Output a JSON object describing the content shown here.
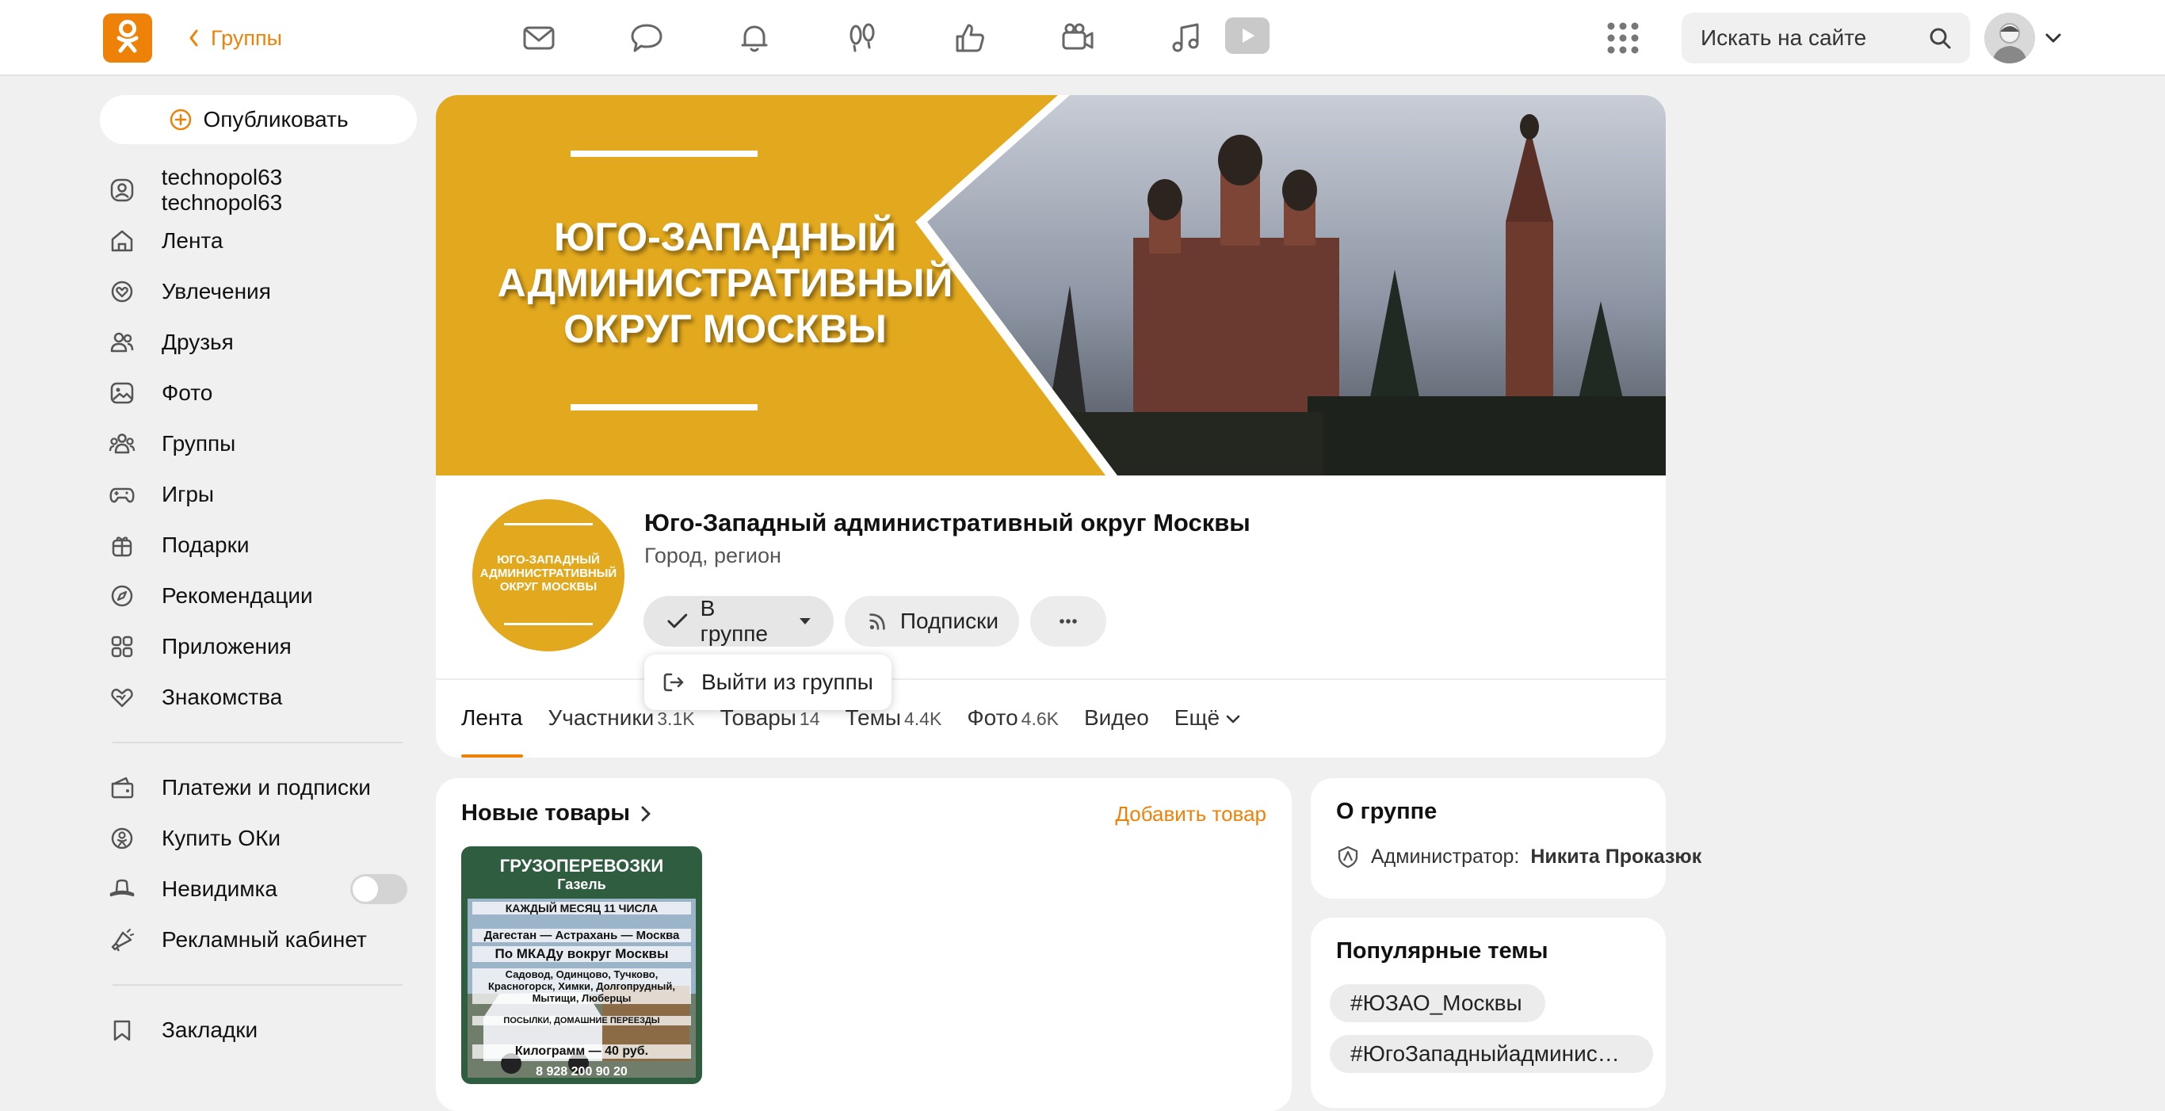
{
  "topbar": {
    "breadcrumb": "Группы",
    "search_placeholder": "Искать на сайте",
    "nav_icons": [
      "mail-icon",
      "chat-icon",
      "bell-icon",
      "guests-icon",
      "like-icon",
      "camera-icon",
      "music-icon",
      "video-icon"
    ]
  },
  "sidebar": {
    "publish_label": "Опубликовать",
    "items": [
      {
        "label": "technopol63 technopol63",
        "icon": "profile-icon"
      },
      {
        "label": "Лента",
        "icon": "home-icon"
      },
      {
        "label": "Увлечения",
        "icon": "hobby-icon"
      },
      {
        "label": "Друзья",
        "icon": "friends-icon"
      },
      {
        "label": "Фото",
        "icon": "photo-icon"
      },
      {
        "label": "Группы",
        "icon": "groups-icon"
      },
      {
        "label": "Игры",
        "icon": "games-icon"
      },
      {
        "label": "Подарки",
        "icon": "gift-icon"
      },
      {
        "label": "Рекомендации",
        "icon": "compass-icon"
      },
      {
        "label": "Приложения",
        "icon": "apps-icon"
      },
      {
        "label": "Знакомства",
        "icon": "dating-icon"
      }
    ],
    "items2": [
      {
        "label": "Платежи и подписки",
        "icon": "wallet-icon"
      },
      {
        "label": "Купить ОКи",
        "icon": "coin-icon"
      },
      {
        "label": "Невидимка",
        "icon": "hat-icon"
      },
      {
        "label": "Рекламный кабинет",
        "icon": "megaphone-icon"
      }
    ],
    "items3": [
      {
        "label": "Закладки",
        "icon": "bookmark-icon"
      }
    ]
  },
  "group": {
    "cover_title_line1": "ЮГО-ЗАПАДНЫЙ",
    "cover_title_line2": "АДМИНИСТРАТИВНЫЙ",
    "cover_title_line3": "ОКРУГ МОСКВЫ",
    "avatar_line1": "ЮГО-ЗАПАДНЫЙ",
    "avatar_line2": "АДМИНИСТРАТИВНЫЙ",
    "avatar_line3": "ОКРУГ МОСКВЫ",
    "name": "Юго-Западный административный округ Москвы",
    "category": "Город, регион",
    "btn_in_group": "В группе",
    "btn_subscriptions": "Подписки",
    "dropdown_leave": "Выйти из группы",
    "tabs": [
      {
        "label": "Лента",
        "count": ""
      },
      {
        "label": "Участники",
        "count": "3.1K"
      },
      {
        "label": "Товары",
        "count": "14"
      },
      {
        "label": "Темы",
        "count": "4.4K"
      },
      {
        "label": "Фото",
        "count": "4.6K"
      },
      {
        "label": "Видео",
        "count": ""
      },
      {
        "label": "Ещё",
        "count": ""
      }
    ]
  },
  "products": {
    "title": "Новые товары",
    "add_label": "Добавить товар",
    "item": {
      "head": "ГРУЗОПЕРЕВОЗКИ",
      "sub": "Газель",
      "line1": "КАЖДЫЙ МЕСЯЦ 11 ЧИСЛА",
      "line2": "Дагестан — Астрахань — Москва",
      "line3": "По МКАДу вокруг Москвы",
      "line4": "Садовод, Одинцово, Тучково, Красногорск, Химки, Долгопрудный, Мытищи, Люберцы",
      "line5": "ПОСЫЛКИ, ДОМАШНИЕ ПЕРЕЕЗДЫ",
      "line6": "Килограмм — 40 руб.",
      "line7": "8 928 200 90 20"
    }
  },
  "about": {
    "title": "О группе",
    "admin_label": "Администратор:",
    "admin_name": "Никита Проказюк"
  },
  "topics": {
    "title": "Популярные темы",
    "chips": [
      "#ЮЗАО_Москвы",
      "#ЮгоЗападныйадминис…"
    ]
  },
  "colors": {
    "accent": "#ee8208",
    "cover_yellow": "#e3a91e",
    "page_bg": "#f0f0f0"
  }
}
